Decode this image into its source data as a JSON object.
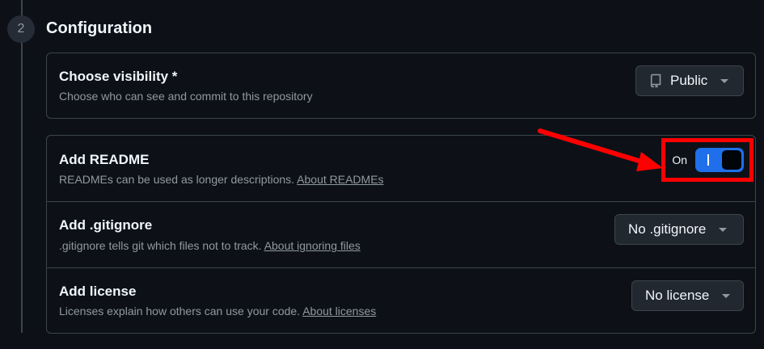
{
  "section": {
    "step_number": "2",
    "title": "Configuration"
  },
  "visibility": {
    "title": "Choose visibility *",
    "description": "Choose who can see and commit to this repository",
    "selected": "Public",
    "icon": "repo-icon"
  },
  "readme": {
    "title": "Add README",
    "description": "READMEs can be used as longer descriptions.",
    "link": "About READMEs",
    "toggle_state": "On",
    "enabled": true
  },
  "gitignore": {
    "title": "Add .gitignore",
    "description": ".gitignore tells git which files not to track.",
    "link": "About ignoring files",
    "selected": "No .gitignore"
  },
  "license": {
    "title": "Add license",
    "description": "Licenses explain how others can use your code.",
    "link": "About licenses",
    "selected": "No license"
  },
  "annotation": {
    "color": "#ff0000"
  },
  "colors": {
    "background": "#0d1117",
    "border": "#3d444d",
    "accent": "#1f6feb",
    "muted_text": "#9198a1"
  }
}
